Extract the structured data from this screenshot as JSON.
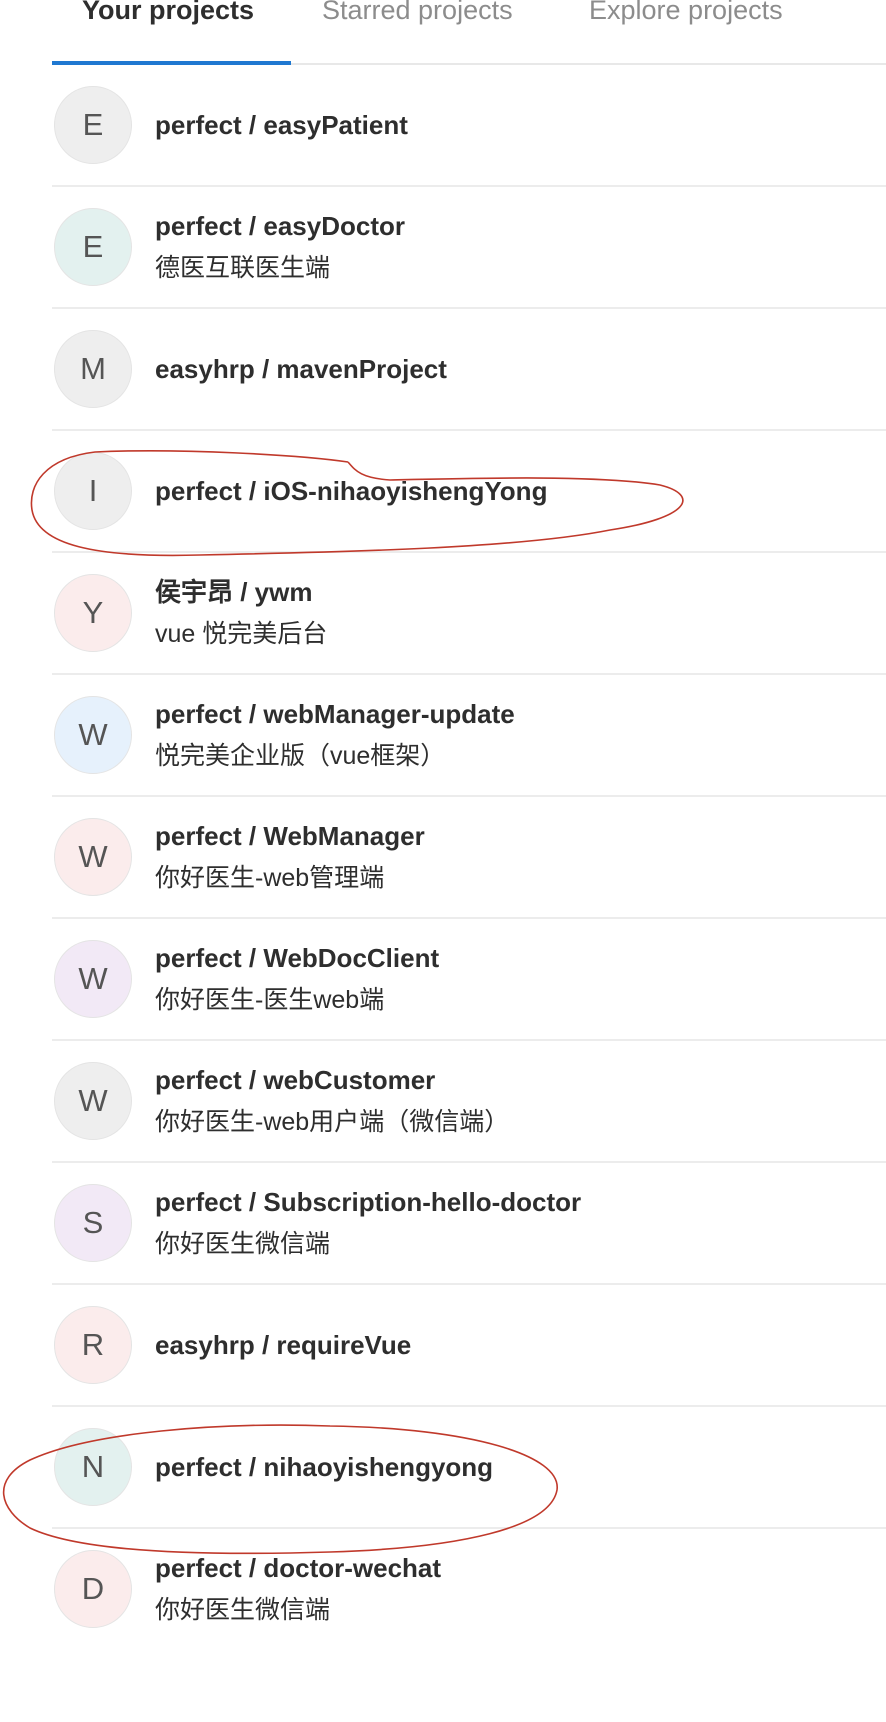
{
  "tabs": [
    {
      "label": "Your projects",
      "active": true
    },
    {
      "label": "Starred projects",
      "active": false
    },
    {
      "label": "Explore projects",
      "active": false
    }
  ],
  "accent_color": "#1f78d1",
  "projects": [
    {
      "initial": "E",
      "title": "perfect / easyPatient",
      "description": "",
      "avatar_color": "#eeeeee"
    },
    {
      "initial": "E",
      "title": "perfect / easyDoctor",
      "description": "德医互联医生端",
      "avatar_color": "#e3f1ef"
    },
    {
      "initial": "M",
      "title": "easyhrp / mavenProject",
      "description": "",
      "avatar_color": "#eeeeee"
    },
    {
      "initial": "I",
      "title": "perfect / iOS-nihaoyishengYong",
      "description": "",
      "avatar_color": "#eeeeee"
    },
    {
      "initial": "Y",
      "title": "侯宇昂 / ywm",
      "description": "vue 悦完美后台",
      "avatar_color": "#fbecec"
    },
    {
      "initial": "W",
      "title": "perfect / webManager-update",
      "description": "悦完美企业版（vue框架）",
      "avatar_color": "#e6f1fc"
    },
    {
      "initial": "W",
      "title": "perfect / WebManager",
      "description": "你好医生-web管理端",
      "avatar_color": "#fbecec"
    },
    {
      "initial": "W",
      "title": "perfect / WebDocClient",
      "description": "你好医生-医生web端",
      "avatar_color": "#f2e9f6"
    },
    {
      "initial": "W",
      "title": "perfect / webCustomer",
      "description": "你好医生-web用户端（微信端）",
      "avatar_color": "#eeeeee"
    },
    {
      "initial": "S",
      "title": "perfect / Subscription-hello-doctor",
      "description": "你好医生微信端",
      "avatar_color": "#f2e9f6"
    },
    {
      "initial": "R",
      "title": "easyhrp / requireVue",
      "description": "",
      "avatar_color": "#fbecec"
    },
    {
      "initial": "N",
      "title": "perfect / nihaoyishengyong",
      "description": "",
      "avatar_color": "#e3f1ef"
    },
    {
      "initial": "D",
      "title": "perfect / doctor-wechat",
      "description": "你好医生微信端",
      "avatar_color": "#fbecec"
    }
  ],
  "annotation_color": "#c0392b"
}
